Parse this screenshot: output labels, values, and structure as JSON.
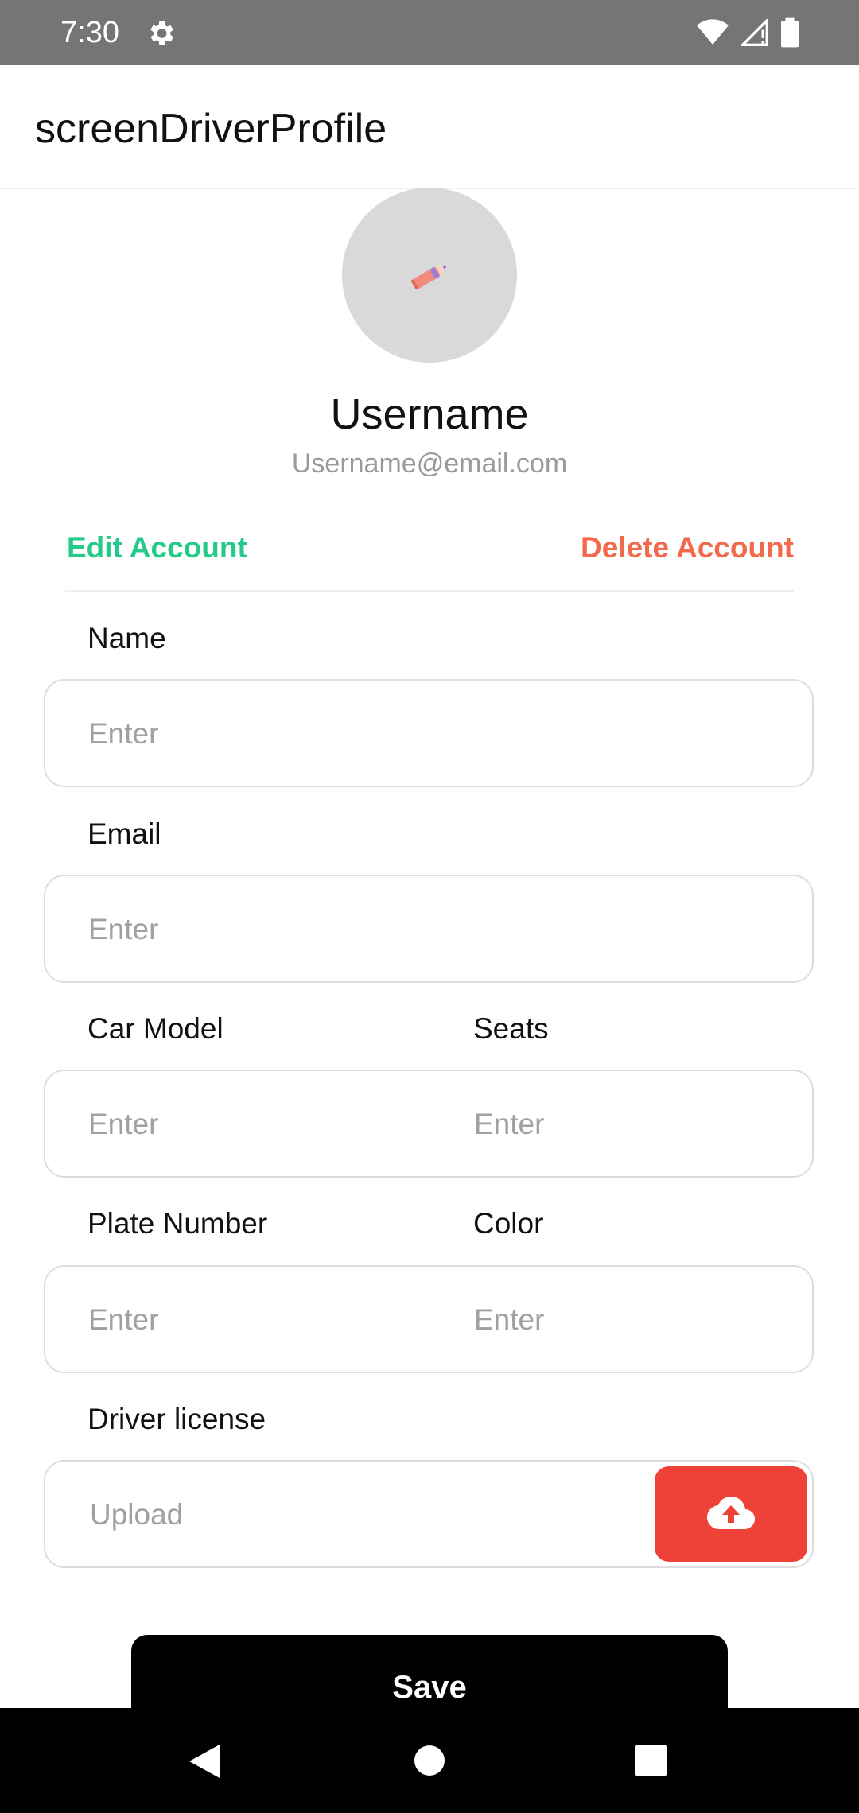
{
  "status_bar": {
    "time": "7:30"
  },
  "app_bar": {
    "title": "screenDriverProfile"
  },
  "profile": {
    "username": "Username",
    "email": "Username@email.com"
  },
  "actions": {
    "edit": "Edit Account",
    "delete": "Delete Account"
  },
  "form": {
    "name": {
      "label": "Name",
      "placeholder": "Enter"
    },
    "email": {
      "label": "Email",
      "placeholder": "Enter"
    },
    "car_model": {
      "label": "Car Model",
      "placeholder": "Enter"
    },
    "seats": {
      "label": "Seats",
      "placeholder": "Enter"
    },
    "plate_number": {
      "label": "Plate Number",
      "placeholder": "Enter"
    },
    "color": {
      "label": "Color",
      "placeholder": "Enter"
    },
    "driver_license": {
      "label": "Driver license",
      "placeholder": "Upload"
    }
  },
  "save_label": "Save",
  "icons": {
    "settings": "gear-icon",
    "wifi": "wifi-icon",
    "signal": "cell-signal-icon",
    "battery": "battery-icon",
    "avatar_edit": "pencil-icon",
    "upload": "cloud-upload-icon",
    "nav_back": "back-triangle-icon",
    "nav_home": "home-circle-icon",
    "nav_recents": "recents-square-icon"
  },
  "colors": {
    "status_bar": "#757575",
    "edit_link": "#25c98a",
    "delete_link": "#f26a4b",
    "upload_button": "#ee4137",
    "save_button": "#000000"
  }
}
